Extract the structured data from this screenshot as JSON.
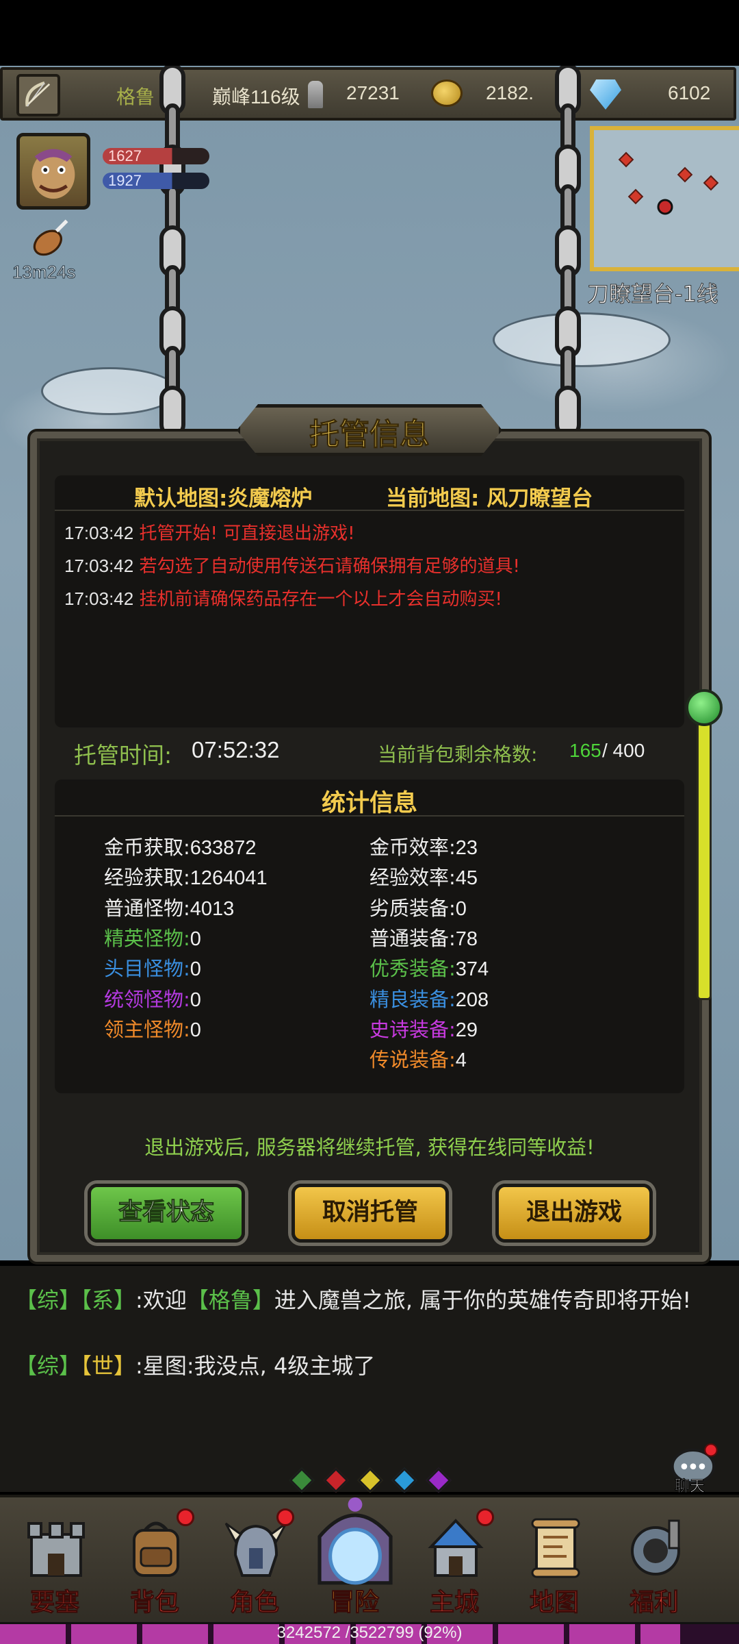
{
  "resources": {
    "hero_name": "格鲁",
    "peak_level": "巅峰116级",
    "attack": "27231",
    "gold": "2182.",
    "diamonds": "6102"
  },
  "hero": {
    "hp_text": "1627",
    "mp_text": "1927",
    "buff_timer": "13m24s"
  },
  "minimap": {
    "map_name": "刀瞭望台-1线"
  },
  "dialog": {
    "title": "托管信息",
    "default_map": "默认地图:炎魔熔炉",
    "current_map": "当前地图: 风刀瞭望台",
    "log": [
      {
        "time": "17:03:42",
        "msg": "托管开始! 可直接退出游戏!"
      },
      {
        "time": "17:03:42",
        "msg": "若勾选了自动使用传送石请确保拥有足够的道具!"
      },
      {
        "time": "17:03:42",
        "msg": "挂机前请确保药品存在一个以上才会自动购买!"
      }
    ],
    "host_time_label": "托管时间:",
    "host_time": "07:52:32",
    "bag_label": "当前背包剩余格数:",
    "bag_free": "165",
    "bag_total": "/ 400",
    "stats_title": "统计信息",
    "stats_left": [
      {
        "label": "金币获取:",
        "value": "633872",
        "color": "#f0f0f0"
      },
      {
        "label": "经验获取:",
        "value": "1264041",
        "color": "#f0f0f0"
      },
      {
        "label": "普通怪物:",
        "value": "4013",
        "color": "#f0f0f0"
      },
      {
        "label": "精英怪物:",
        "value": "0",
        "color": "#5bc04a"
      },
      {
        "label": "头目怪物:",
        "value": "0",
        "color": "#3a8fe0"
      },
      {
        "label": "统领怪物:",
        "value": "0",
        "color": "#b43ae0"
      },
      {
        "label": "领主怪物:",
        "value": "0",
        "color": "#f08a2a"
      }
    ],
    "stats_right": [
      {
        "label": "金币效率:",
        "value": "23",
        "color": "#f0f0f0"
      },
      {
        "label": "经验效率:",
        "value": "45",
        "color": "#f0f0f0"
      },
      {
        "label": "劣质装备:",
        "value": "0",
        "color": "#f0f0f0"
      },
      {
        "label": "普通装备:",
        "value": "78",
        "color": "#f0f0f0"
      },
      {
        "label": "优秀装备:",
        "value": "374",
        "color": "#5bc04a"
      },
      {
        "label": "精良装备:",
        "value": "208",
        "color": "#3a8fe0"
      },
      {
        "label": "史诗装备:",
        "value": "29",
        "color": "#c83ae0"
      },
      {
        "label": "传说装备:",
        "value": "4",
        "color": "#f08a2a"
      }
    ],
    "notice": "退出游戏后, 服务器将继续托管, 获得在线同等收益!",
    "btn_status": "查看状态",
    "btn_cancel": "取消托管",
    "btn_exit": "退出游戏"
  },
  "chat": {
    "line1": {
      "channel": "【综】",
      "type": "【系】",
      "pre": ":欢迎",
      "name": "【格鲁】",
      "post": "进入魔兽之旅, 属于你的英雄传奇即将开始!"
    },
    "line2": {
      "channel": "【综】",
      "type": "【世】",
      "msg": ":星图:我没点, 4级主城了"
    },
    "chat_label": "聊天"
  },
  "page_dots": [
    "#3a8a3a",
    "#c8242a",
    "#d8c22a",
    "#2a9ad8",
    "#9a2ac8"
  ],
  "nav": [
    {
      "label": "要塞",
      "icon": "fortress-icon",
      "badge": false
    },
    {
      "label": "背包",
      "icon": "backpack-icon",
      "badge": true
    },
    {
      "label": "角色",
      "icon": "helmet-icon",
      "badge": true
    },
    {
      "label": "冒险",
      "icon": "portal-icon",
      "badge": false
    },
    {
      "label": "主城",
      "icon": "castle-icon",
      "badge": true
    },
    {
      "label": "地图",
      "icon": "scroll-map-icon",
      "badge": false
    },
    {
      "label": "福利",
      "icon": "gift-icon",
      "badge": false
    }
  ],
  "exp": {
    "text": "3242572 /3522799 (92%)",
    "progress": 0.92
  }
}
